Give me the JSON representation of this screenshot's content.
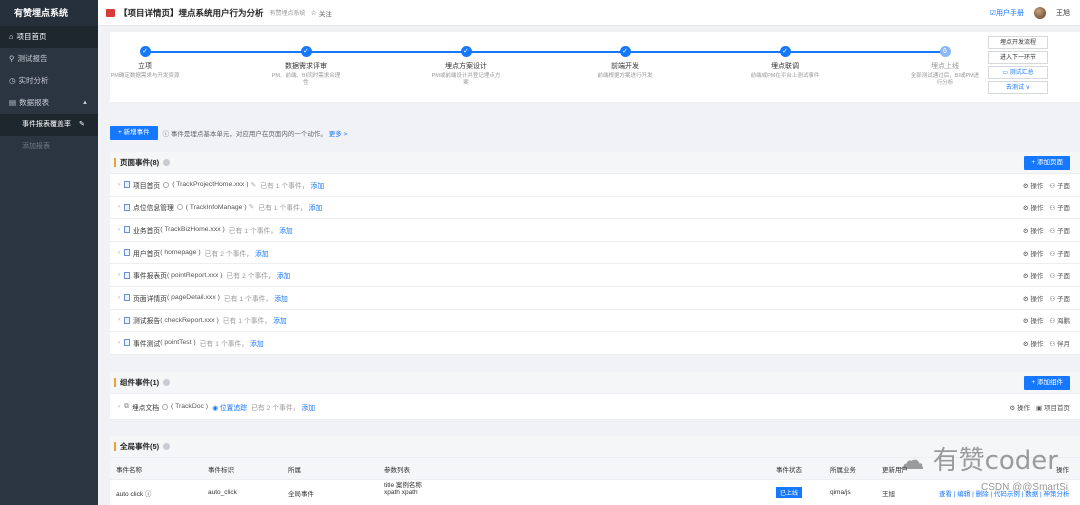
{
  "sidebar": {
    "brand": "有赞埋点系统",
    "items": [
      {
        "label": "项目首页",
        "icon": "home-icon"
      },
      {
        "label": "测试报告",
        "icon": "report-icon"
      },
      {
        "label": "实时分析",
        "icon": "clock-icon"
      },
      {
        "label": "数据报表",
        "icon": "chart-icon"
      }
    ],
    "subitems": [
      {
        "label": "事件报表覆盖率"
      },
      {
        "label": "添加报表"
      }
    ]
  },
  "header": {
    "title": "【项目详情页】埋点系统用户行为分析",
    "system": "有赞埋点系统",
    "follow": "关注",
    "manual": "用户手册",
    "username": "王旭"
  },
  "steps": [
    {
      "num": "✓",
      "title": "立项",
      "desc": "PM确定数据需求与开发资源"
    },
    {
      "num": "✓",
      "title": "数据需求评审",
      "desc": "PM、前端、BI同时需求合理性"
    },
    {
      "num": "✓",
      "title": "埋点方案设计",
      "desc": "PM或前端设计并登记埋点方案"
    },
    {
      "num": "✓",
      "title": "前端开发",
      "desc": "前端根据方案进行开发"
    },
    {
      "num": "✓",
      "title": "埋点联调",
      "desc": "前端或PM在平台上测试事件"
    },
    {
      "num": "6",
      "title": "埋点上线",
      "desc": "全部测试通过后，BI或PM进行分析"
    }
  ],
  "step_buttons": {
    "flow": "埋点开发流程",
    "next": "进入下一环节",
    "summary": "测试汇总",
    "goto_test": "去测试 ∨"
  },
  "toolbar": {
    "new_event": "+ 新增事件",
    "hint": "ⓘ 事件是埋点基本单元，对应用户在页面内的一个动作。",
    "more": "更多 >"
  },
  "page_events": {
    "title": "页面事件(8)",
    "add_button": "+ 添加页面",
    "rows": [
      {
        "name": "项目首页",
        "code": "( TrackProjectHome.xxx )",
        "count": "已有 1 个事件，",
        "add": "添加",
        "a1": "⚙ 操作",
        "a2": "⚇ 子面"
      },
      {
        "name": "点位信息管理",
        "code": "( TrackInfoManage )",
        "count": "已有 1 个事件，",
        "add": "添加",
        "a1": "⚙ 操作",
        "a2": "⚇ 子面"
      },
      {
        "name": "业务首页",
        "code": "( TrackBizHome.xxx )",
        "count": "已有 1 个事件，",
        "add": "添加",
        "a1": "⚙ 操作",
        "a2": "⚇ 子面"
      },
      {
        "name": "用户首页",
        "code": "( homepage )",
        "count": "已有 2 个事件，",
        "add": "添加",
        "a1": "⚙ 操作",
        "a2": "⚇ 子面"
      },
      {
        "name": "事件报表页",
        "code": "( pointReport.xxx )",
        "count": "已有 2 个事件，",
        "add": "添加",
        "a1": "⚙ 操作",
        "a2": "⚇ 子面"
      },
      {
        "name": "页面详情页",
        "code": "( pageDetail.xxx )",
        "count": "已有 1 个事件，",
        "add": "添加",
        "a1": "⚙ 操作",
        "a2": "⚇ 子面"
      },
      {
        "name": "测试报告",
        "code": "( checkReport.xxx )",
        "count": "已有 1 个事件，",
        "add": "添加",
        "a1": "⚙ 操作",
        "a2": "⚇ 海鹏"
      },
      {
        "name": "事件测试",
        "code": "( pointTest )",
        "count": "已有 1 个事件，",
        "add": "添加",
        "a1": "⚙ 操作",
        "a2": "⚇ 伴月"
      }
    ]
  },
  "component_events": {
    "title": "组件事件(1)",
    "add_button": "+ 添加组件",
    "row": {
      "name": "埋点文档",
      "code": "( TrackDoc )",
      "pos": "位置追踪",
      "count": "已有 2 个事件，",
      "add": "添加",
      "a1": "⚙ 操作",
      "a2": "▣ 项目首页"
    }
  },
  "global_events": {
    "title": "全局事件(5)",
    "columns": [
      "事件名称",
      "事件标识",
      "所属",
      "参数列表",
      "事件状态",
      "所属业务",
      "更新用户",
      "操作"
    ],
    "row": {
      "name": "auto click",
      "code": "auto_click",
      "owner": "全局事件",
      "params1": "title 案例名称",
      "params2": "xpath xpath",
      "status": "已上线",
      "biz": "qima/js",
      "user": "王旭",
      "ops": "查看 | 编辑 | 删除 | 代码示例 | 数据 | 神策分析"
    }
  },
  "watermark": {
    "brand": "有赞coder",
    "sub": "CSDN @@SmartSi"
  }
}
